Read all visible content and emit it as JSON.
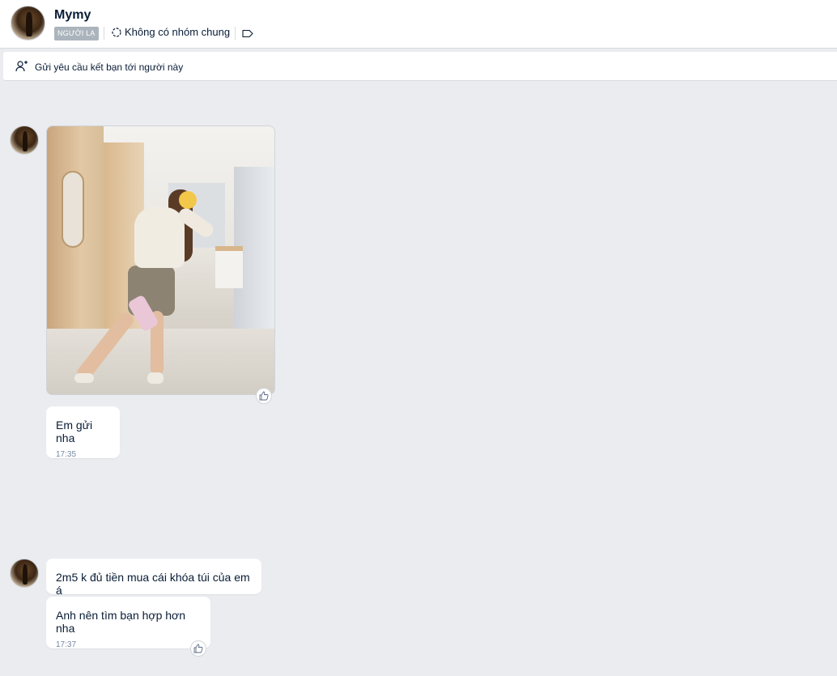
{
  "header": {
    "name": "Mymy",
    "badge": "NGƯỜI LẠ",
    "common_groups": "Không có nhóm chung"
  },
  "friend_request": {
    "label": "Gửi yêu cầu kết bạn tới người này"
  },
  "messages": [
    {
      "type": "image"
    },
    {
      "type": "text",
      "text": "Em gửi nha",
      "time": "17:35"
    },
    {
      "type": "text",
      "text": "2m5 k đủ tiền mua cái khóa túi của em á"
    },
    {
      "type": "text",
      "text": "Anh nên tìm bạn hợp hơn nha",
      "time": "17:37"
    }
  ]
}
